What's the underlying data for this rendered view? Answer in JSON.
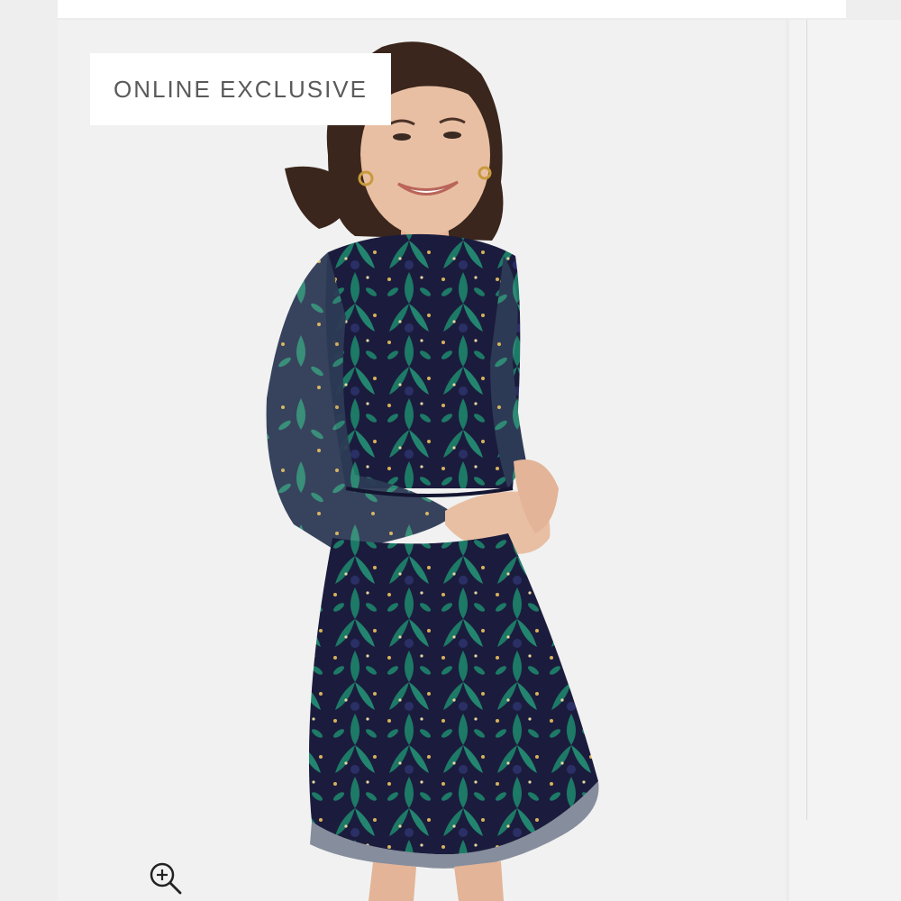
{
  "product_image": {
    "badge_label": "ONLINE EXCLUSIVE",
    "zoom_icon": "zoom-in-icon",
    "colors": {
      "dress_navy": "#1b1c3d",
      "dress_teal": "#1d7a66",
      "dress_gold": "#d8b25a",
      "hair_brown": "#3a261c",
      "skin": "#e9bfa3",
      "background": "#f1f1f1"
    }
  }
}
